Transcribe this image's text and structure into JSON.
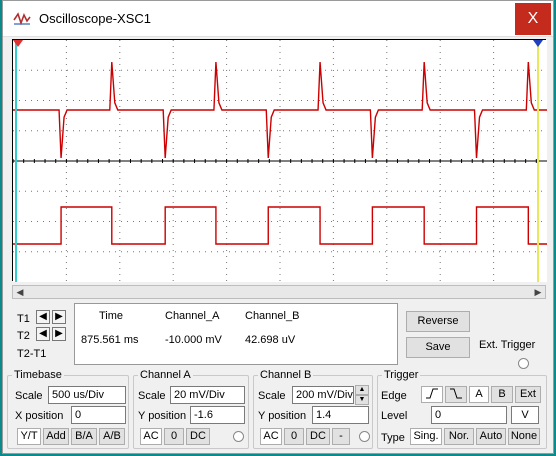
{
  "window": {
    "title": "Oscilloscope-XSC1",
    "close_glyph": "X"
  },
  "screen": {
    "bg": "#ffffff",
    "trace_color": "#cc0000",
    "cursor1_color": "#33cccc",
    "cursor2_color": "#e8e85a",
    "cursor1_marker": "1",
    "cursor2_marker": "2",
    "channel_a": {
      "kind": "spike",
      "baseline": 0,
      "high": 1,
      "low": -1,
      "edges_pos": [
        0.185,
        0.38,
        0.575,
        0.77,
        0.965
      ],
      "edges_neg": [
        0.09,
        0.285,
        0.478,
        0.673,
        0.868
      ]
    },
    "channel_b": {
      "kind": "square",
      "levels": [
        0,
        1
      ],
      "high_intervals": [
        [
          0.09,
          0.185
        ],
        [
          0.285,
          0.38
        ],
        [
          0.478,
          0.575
        ],
        [
          0.673,
          0.77
        ],
        [
          0.868,
          0.965
        ]
      ]
    }
  },
  "readout": {
    "t1_label": "T1",
    "t2_label": "T2",
    "t2t1_label": "T2-T1",
    "col_time": "Time",
    "col_a": "Channel_A",
    "col_b": "Channel_B",
    "time_val": "875.561 ms",
    "a_val": "-10.000 mV",
    "b_val": "42.698 uV",
    "reverse": "Reverse",
    "save": "Save",
    "ext_trigger": "Ext. Trigger"
  },
  "timebase": {
    "legend": "Timebase",
    "scale_label": "Scale",
    "scale": "500 us/Div",
    "xpos_label": "X position",
    "xpos": "0",
    "modes": [
      "Y/T",
      "Add",
      "B/A",
      "A/B"
    ]
  },
  "channel_a": {
    "legend": "Channel A",
    "scale_label": "Scale",
    "scale": "20 mV/Div",
    "ypos_label": "Y position",
    "ypos": "-1.6",
    "coupling": [
      "AC",
      "0",
      "DC"
    ]
  },
  "channel_b": {
    "legend": "Channel B",
    "scale_label": "Scale",
    "scale": "200 mV/Div",
    "ypos_label": "Y position",
    "ypos": "1.4",
    "coupling": [
      "AC",
      "0",
      "DC",
      "-"
    ]
  },
  "trigger": {
    "legend": "Trigger",
    "edge_label": "Edge",
    "edge_buttons": [
      "A",
      "B",
      "Ext"
    ],
    "level_label": "Level",
    "level": "0",
    "level_unit": "V",
    "type_label": "Type",
    "types": [
      "Sing.",
      "Nor.",
      "Auto",
      "None"
    ]
  }
}
